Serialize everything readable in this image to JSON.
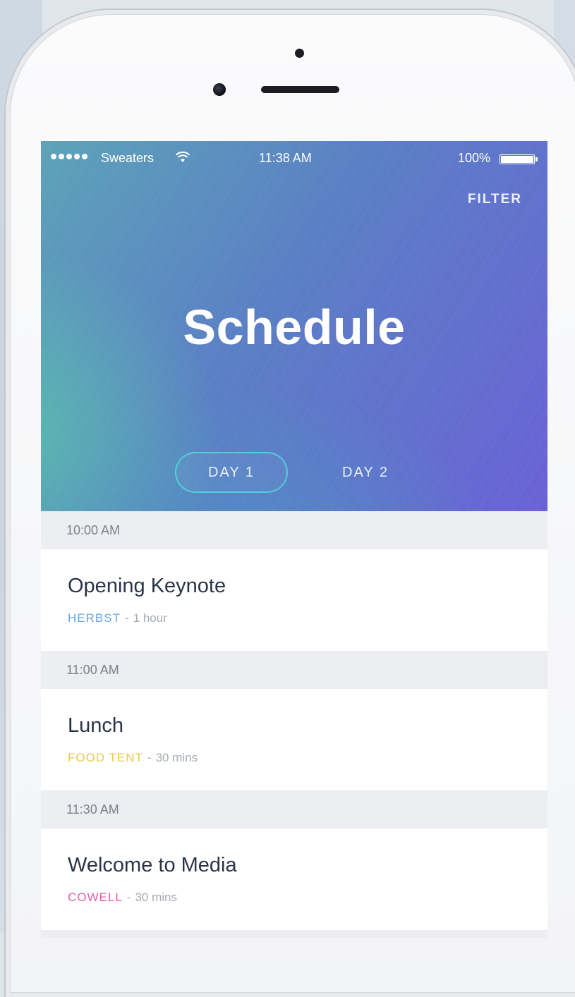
{
  "status_bar": {
    "carrier": "Sweaters",
    "time": "11:38 AM",
    "battery": "100%"
  },
  "header": {
    "filter_label": "FILTER",
    "title": "Schedule",
    "tabs": [
      {
        "label": "DAY 1",
        "active": true
      },
      {
        "label": "DAY 2",
        "active": false
      }
    ]
  },
  "schedule": [
    {
      "time": "10:00 AM",
      "title": "Opening Keynote",
      "location": "HERBST",
      "location_color": "#6aa7dd",
      "duration": "1 hour"
    },
    {
      "time": "11:00 AM",
      "title": "Lunch",
      "location": "FOOD TENT",
      "location_color": "#e8c94a",
      "duration": "30 mins"
    },
    {
      "time": "11:30 AM",
      "title": "Welcome to Media",
      "location": "COWELL",
      "location_color": "#e25fa3",
      "duration": "30 mins"
    }
  ],
  "meta_separator": "-",
  "colors": {
    "gradient_start": "#5da3b8",
    "gradient_end": "#6a62d6",
    "tab_active_border": "#50e6dc",
    "section_bg": "#edeef1",
    "title_text": "#2b3447"
  },
  "icons": [
    "signal-dots-icon",
    "wifi-icon",
    "battery-icon"
  ]
}
